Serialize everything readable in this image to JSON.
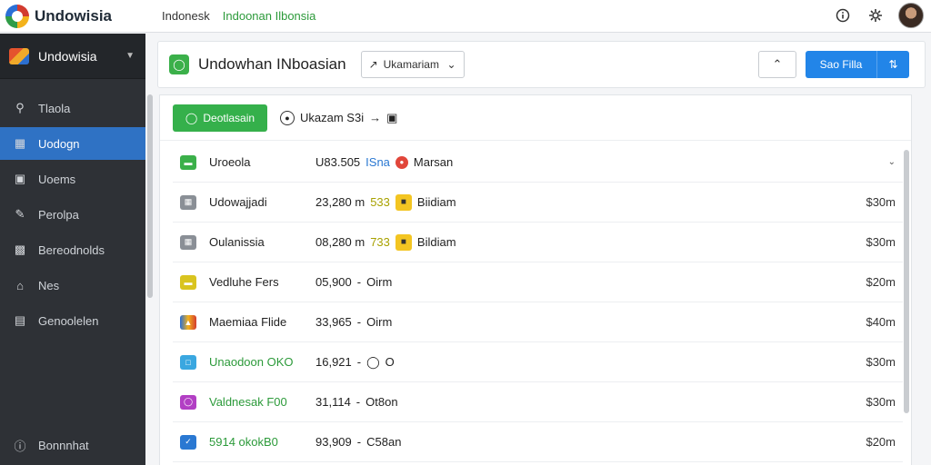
{
  "topbar": {
    "app_name": "Undowisia",
    "crumbs": [
      "Indonesk",
      "Indoonan Ilbonsia"
    ],
    "icons": [
      "info-icon",
      "settings-gear-icon"
    ]
  },
  "sidebar": {
    "header_title": "Undowisia",
    "items": [
      {
        "label": "Tlaola",
        "icon": "search-icon"
      },
      {
        "label": "Uodogn",
        "icon": "grid-icon"
      },
      {
        "label": "Uoems",
        "icon": "image-icon"
      },
      {
        "label": "Perolpa",
        "icon": "pen-icon"
      },
      {
        "label": "Bereodnolds",
        "icon": "folder-icon"
      },
      {
        "label": "Nes",
        "icon": "home-icon"
      },
      {
        "label": "Genoolelen",
        "icon": "document-icon"
      }
    ],
    "active_index": 1,
    "bottom_item": {
      "label": "Bonnnhat",
      "icon": "info-icon"
    }
  },
  "header": {
    "title": "Undowhan INboasian",
    "select_value": "Ukamariam",
    "primary_button": "Sao Filla"
  },
  "toolbar": {
    "green_button": "Deotlasain",
    "filter_label": "Ukazam S3i"
  },
  "rows": [
    {
      "name": "Uroeola",
      "meta1": "U83.505",
      "meta2": "ISna",
      "meta3": "Marsan",
      "value": "",
      "expand": true
    },
    {
      "name": "Udowajjadi",
      "meta1": "23,280 m",
      "meta2": "533",
      "meta3": "Biidiam",
      "value": "$30m"
    },
    {
      "name": "Oulanissia",
      "meta1": "08,280 m",
      "meta2": "733",
      "meta3": "Bildiam",
      "value": "$30m"
    },
    {
      "name": "Vedluhe Fers",
      "meta1": "05,900",
      "meta2": "",
      "meta3": "Oirm",
      "value": "$20m"
    },
    {
      "name": "Maemiaa Flide",
      "meta1": "33,965",
      "meta2": "",
      "meta3": "Oirm",
      "value": "$40m"
    },
    {
      "name": "Unaodoon OKO",
      "meta1": "16,921",
      "meta2": "",
      "meta3": "O",
      "value": "$30m"
    },
    {
      "name": "Valdnesak F00",
      "meta1": "31,114",
      "meta2": "",
      "meta3": "Ot8on",
      "value": "$30m"
    },
    {
      "name": "5914 okokB0",
      "meta1": "93,909",
      "meta2": "",
      "meta3": "C58an",
      "value": "$20m"
    }
  ]
}
